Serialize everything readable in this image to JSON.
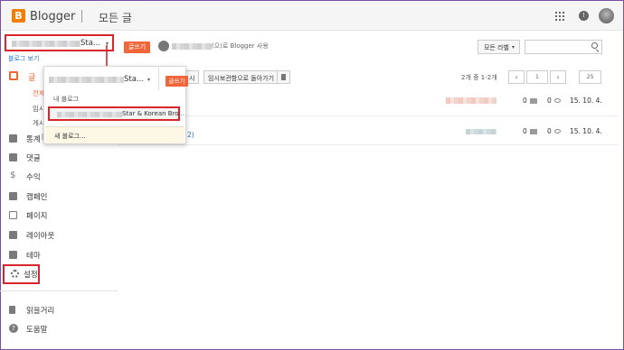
{
  "header": {
    "logo_letter": "B",
    "app_name": "Blogger",
    "page_title": "모든 글",
    "bell_glyph": "!",
    "icons": [
      "apps-grid-icon",
      "notification-bell-icon",
      "account-avatar"
    ]
  },
  "blog_selector": {
    "selected_suffix": "Sta...",
    "caret": "▾",
    "new_post_label": "글쓰기"
  },
  "author": {
    "suffix": "(으)로 Blogger 사용"
  },
  "filters": {
    "labels_dropdown": "모든 라벨",
    "search_placeholder": ""
  },
  "sidebar": {
    "view_blog": "블로그 보기",
    "posts": "글",
    "posts_subitems": [
      "전체",
      "임시",
      "게시"
    ],
    "items": [
      {
        "label": "통계",
        "icon": "stats-icon"
      },
      {
        "label": "댓글",
        "icon": "comments-icon"
      },
      {
        "label": "수익",
        "icon": "earnings-dollar-icon",
        "glyph": "$"
      },
      {
        "label": "캠페인",
        "icon": "campaigns-icon"
      },
      {
        "label": "페이지",
        "icon": "pages-icon"
      },
      {
        "label": "레이아웃",
        "icon": "layout-icon"
      },
      {
        "label": "테마",
        "icon": "theme-icon"
      },
      {
        "label": "설정",
        "icon": "settings-gear-icon"
      },
      {
        "label": "읽을거리",
        "icon": "reading-list-bookmark-icon"
      },
      {
        "label": "도움말",
        "icon": "help-icon",
        "glyph": "?"
      }
    ]
  },
  "toolbar": {
    "partial_label": "시",
    "revert_to_draft": "임시보관함으로 돌아가기"
  },
  "pagination": {
    "range_text": "2개 중 1-2개",
    "prev": "‹",
    "page": "1",
    "next": "›",
    "page_size": "25"
  },
  "posts": [
    {
      "comments": "0",
      "views": "0",
      "date": "15. 10. 4."
    },
    {
      "comments": "0",
      "views": "0",
      "date": "15. 10. 4.",
      "title_tail": "2)"
    }
  ],
  "blog_dropdown": {
    "selected_suffix": "Sta...",
    "new_post_label": "글쓰기",
    "my_blogs_header": "내 블로그",
    "blog_item_suffix": "Star & Korean Bro...",
    "new_blog": "새 블로그..."
  }
}
